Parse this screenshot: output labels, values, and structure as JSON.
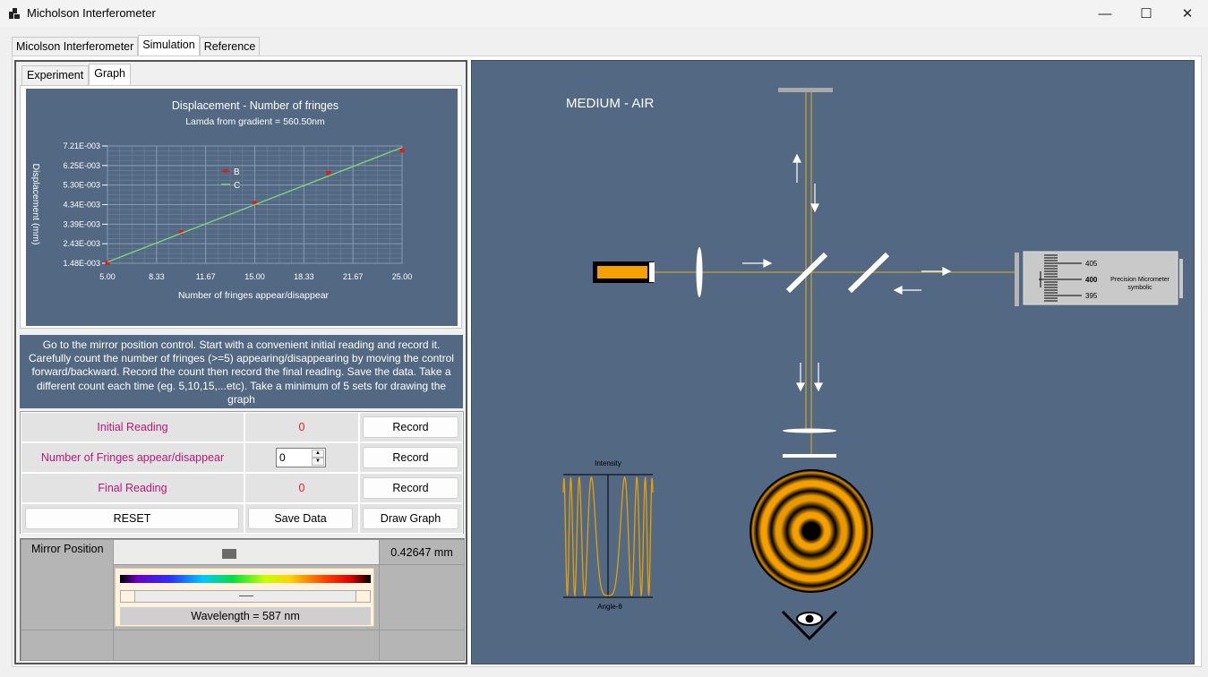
{
  "window": {
    "title": "Micholson Interferometer",
    "minimize": "—",
    "maximize": "☐",
    "close": "✕"
  },
  "tabs": [
    "Micolson Interferometer",
    "Simulation",
    "Reference"
  ],
  "subtabs": [
    "Experiment",
    "Graph"
  ],
  "graph": {
    "title": "Displacement - Number of fringes",
    "subtitle": "Lamda from gradient = 560.50nm",
    "xlabel": "Number of fringes appear/disappear",
    "ylabel": "Displacement (mm)",
    "legend_b": "B",
    "legend_c": "C"
  },
  "chart_data": {
    "type": "scatter",
    "title": "Displacement - Number of fringes",
    "subtitle": "Lamda from gradient = 560.50nm",
    "xlabel": "Number of fringes appear/disappear",
    "ylabel": "Displacement (mm)",
    "x_ticks": [
      "5.00",
      "8.33",
      "11.67",
      "15.00",
      "18.33",
      "21.67",
      "25.00"
    ],
    "y_ticks": [
      "1.48E-003",
      "2.43E-003",
      "3.39E-003",
      "4.34E-003",
      "5.30E-003",
      "6.25E-003",
      "7.21E-003"
    ],
    "xlim": [
      5,
      25
    ],
    "ylim": [
      0.00148,
      0.00721
    ],
    "grid": true,
    "legend_position": "top-left",
    "series": [
      {
        "name": "B",
        "kind": "points",
        "color": "#d42020",
        "x": [
          5,
          10,
          15,
          20,
          25
        ],
        "y": [
          0.00151,
          0.00299,
          0.00441,
          0.00589,
          0.007
        ]
      },
      {
        "name": "C",
        "kind": "line",
        "color": "#7fd27f",
        "x": [
          5,
          25
        ],
        "y": [
          0.00154,
          0.00714
        ]
      }
    ]
  },
  "instruction": "Go to the mirror position control. Start with a convenient initial reading and record it. Carefully count the number of fringes (>=5) appearing/disappearing by moving the control forward/backward. Record the count then record the final reading. Save the data. Take a different count each time (eg. 5,10,15,...etc).  Take a minimum of 5 sets for drawing the graph",
  "controls": {
    "initial_label": "Initial Reading",
    "initial_value": "0",
    "fringes_label": "Number of Fringes appear/disappear",
    "fringes_value": "0",
    "final_label": "Final Reading",
    "final_value": "0",
    "record": "Record",
    "reset": "RESET",
    "save": "Save Data",
    "draw": "Draw Graph"
  },
  "mirror": {
    "label": "Mirror Position",
    "value": "0.42647 mm",
    "slider_fraction": 0.43,
    "wavelength_label": "Wavelength = 587 nm",
    "wavelength_fraction": 0.5
  },
  "sim": {
    "medium": "MEDIUM - AIR",
    "intensity_label": "Intensity",
    "angle_label": "Angle-θ",
    "micrometer_label_1": "Precision Micrometer",
    "micrometer_label_2": "symbolic",
    "micrometer_405": "405",
    "micrometer_400": "400",
    "micrometer_395": "395"
  }
}
